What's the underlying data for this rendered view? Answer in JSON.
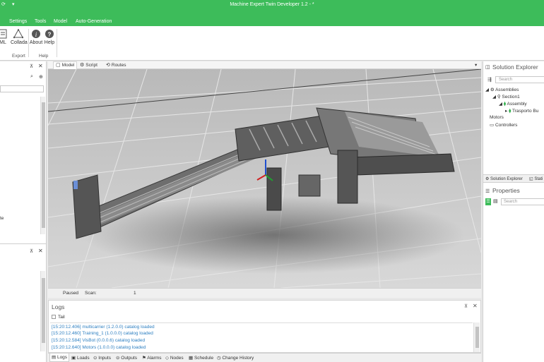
{
  "window": {
    "title": "Machine Expert Twin Developer 1.2 - *"
  },
  "menu": {
    "items": [
      "Settings",
      "Tools",
      "Model",
      "Auto-Generation"
    ]
  },
  "ribbon": {
    "buttons": [
      {
        "label": "ML",
        "icon": "xml-icon"
      },
      {
        "label": "Collada",
        "icon": "collada-icon"
      },
      {
        "label": "About",
        "icon": "info-icon"
      },
      {
        "label": "Help",
        "icon": "help-icon"
      }
    ],
    "groups": [
      "Export",
      "Help"
    ]
  },
  "center_tabs": [
    "Model",
    "Script",
    "Routes"
  ],
  "status": {
    "state": "Paused",
    "scan_label": "Scan:",
    "scan_value": "1"
  },
  "logs": {
    "title": "Logs",
    "tail_label": "Tail",
    "lines": [
      "[15:20:12.406] multicarrier (1.2.0.0) catalog loaded",
      "[15:20:12.460] Training_1 (1.0.0.0) catalog loaded",
      "[15:20:12.584] VisBot (0.0.0.6) catalog loaded",
      "[15:20:12.640] Motors (1.0.0.0) catalog loaded"
    ]
  },
  "bottom_tabs": [
    "Logs",
    "Loads",
    "Inputs",
    "Outputs",
    "Alarms",
    "Nodes",
    "Schedule",
    "Change History"
  ],
  "solution_explorer": {
    "title": "Solution Explorer",
    "search_placeholder": "Search",
    "tree": [
      {
        "label": "Assemblies",
        "level": 0
      },
      {
        "label": "Section1",
        "level": 1
      },
      {
        "label": "Assembly",
        "level": 2
      },
      {
        "label": "Trasporto Bu",
        "level": 3
      },
      {
        "label": "Motors",
        "level": 0
      },
      {
        "label": "Controllers",
        "level": 0
      }
    ],
    "tabs": [
      "Solution Explorer",
      "Stati"
    ]
  },
  "properties": {
    "title": "Properties",
    "search_placeholder": "Search"
  },
  "left_pane": {
    "fragment_text": "te"
  },
  "colors": {
    "accent": "#3dbc5a",
    "log_text": "#2d7fc1"
  }
}
